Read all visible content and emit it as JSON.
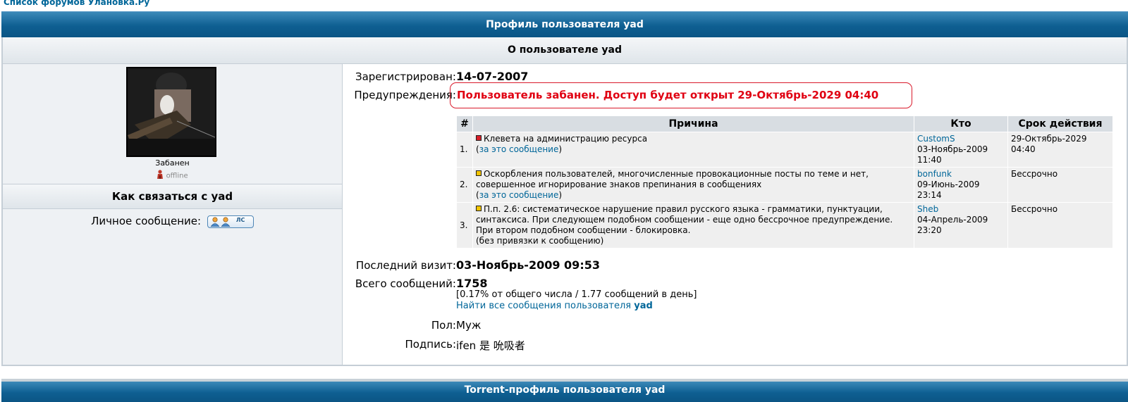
{
  "breadcrumb": "Список форумов Улановка.Ру",
  "profile_bar": "Профиль пользователя yad",
  "about_header": "О пользователе yad",
  "left": {
    "rank": "Забанен",
    "status": "offline",
    "contact_header": "Как связаться с yad",
    "pm_label": "Личное сообщение:",
    "pm_button_text": "ЛС"
  },
  "info": {
    "registered_label": "Зарегистрирован:",
    "registered_value": "14-07-2007",
    "warnings_label": "Предупреждения:",
    "ban_message": "Пользователь забанен. Доступ будет открыт 29-Октябрь-2029 04:40",
    "last_visit_label": "Последний визит:",
    "last_visit_value": "03-Ноябрь-2009 09:53",
    "posts_label": "Всего сообщений:",
    "posts_value": "1758",
    "posts_stats": "[0.17% от общего числа / 1.77 сообщений в день]",
    "find_posts_prefix": "Найти все сообщения пользователя",
    "find_posts_user": "yad",
    "gender_label": "Пол:",
    "gender_value": "Муж",
    "signature_label": "Подпись:",
    "signature_value": "ifen 是 吮吸者"
  },
  "warnings_table": {
    "headers": [
      "#",
      "Причина",
      "Кто",
      "Срок действия"
    ],
    "rows": [
      {
        "num": "1.",
        "reason": "Клевета на администрацию ресурса",
        "link": "за это сообщение",
        "who": "CustomS",
        "who_date": "03-Ноябрь-2009",
        "who_time": "11:40",
        "term": "29-Октябрь-2029",
        "term_time": "04:40"
      },
      {
        "num": "2.",
        "reason": "Оскорбления пользователей, многочисленные провокационные посты по теме и нет, совершенное игнорирование знаков препинания в сообщениях",
        "link": "за это сообщение",
        "who": "bonfunk",
        "who_date": "09-Июнь-2009",
        "who_time": "23:14",
        "term": "Бессрочно",
        "term_time": ""
      },
      {
        "num": "3.",
        "reason": "П.п. 2.6: систематическое нарушение правил русского языка - грамматики, пунктуации, синтаксиса. При следующем подобном сообщении - еще одно бессрочное предупреждение. При втором подобном сообщении - блокировка.",
        "link": "(без привязки к сообщению)",
        "who": "Sheb",
        "who_date": "04-Апрель-2009",
        "who_time": "23:20",
        "term": "Бессрочно",
        "term_time": ""
      }
    ]
  },
  "torrent_bar": "Torrent-профиль пользователя yad",
  "colors": {
    "header_blue": "#0e5f92",
    "link": "#006699",
    "ban_red": "#e00012",
    "panel_bg": "#eef1f4"
  }
}
